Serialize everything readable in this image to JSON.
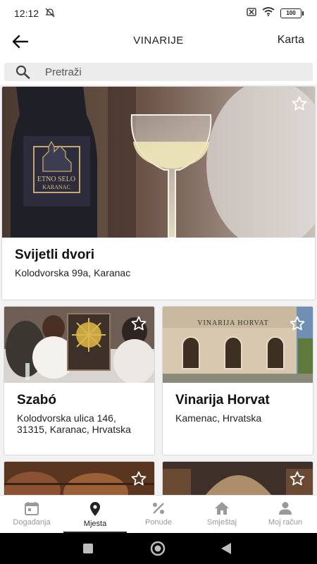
{
  "status_bar": {
    "time": "12:12",
    "battery": "100"
  },
  "app_bar": {
    "title": "VINARIJE",
    "map_label": "Karta"
  },
  "search": {
    "placeholder": "Pretraži"
  },
  "wineries": [
    {
      "name": "Svijetli dvori",
      "address": "Kolodvorska 99a, Karanac",
      "label_text": "ETNO SELO",
      "label_sub": "KARANAC"
    },
    {
      "name": "Szabó",
      "address": "Kolodvorska ulica 146, 31315, Karanac, Hrvatska"
    },
    {
      "name": "Vinarija Horvat",
      "address": "Kamenac, Hrvatska",
      "sign_text": "VINARIJA HORVAT"
    },
    {
      "name": "",
      "address": ""
    },
    {
      "name": "",
      "address": ""
    }
  ],
  "bottom_nav": [
    {
      "label": "Događanja",
      "icon": "calendar-icon"
    },
    {
      "label": "Mjesta",
      "icon": "location-pin-icon",
      "active": true
    },
    {
      "label": "Ponude",
      "icon": "percent-icon"
    },
    {
      "label": "Smještaj",
      "icon": "home-icon"
    },
    {
      "label": "Moj račun",
      "icon": "person-icon"
    }
  ],
  "colors": {
    "accent": "#222222",
    "inactive": "#9a9a9a",
    "background": "#f2f2f2"
  }
}
